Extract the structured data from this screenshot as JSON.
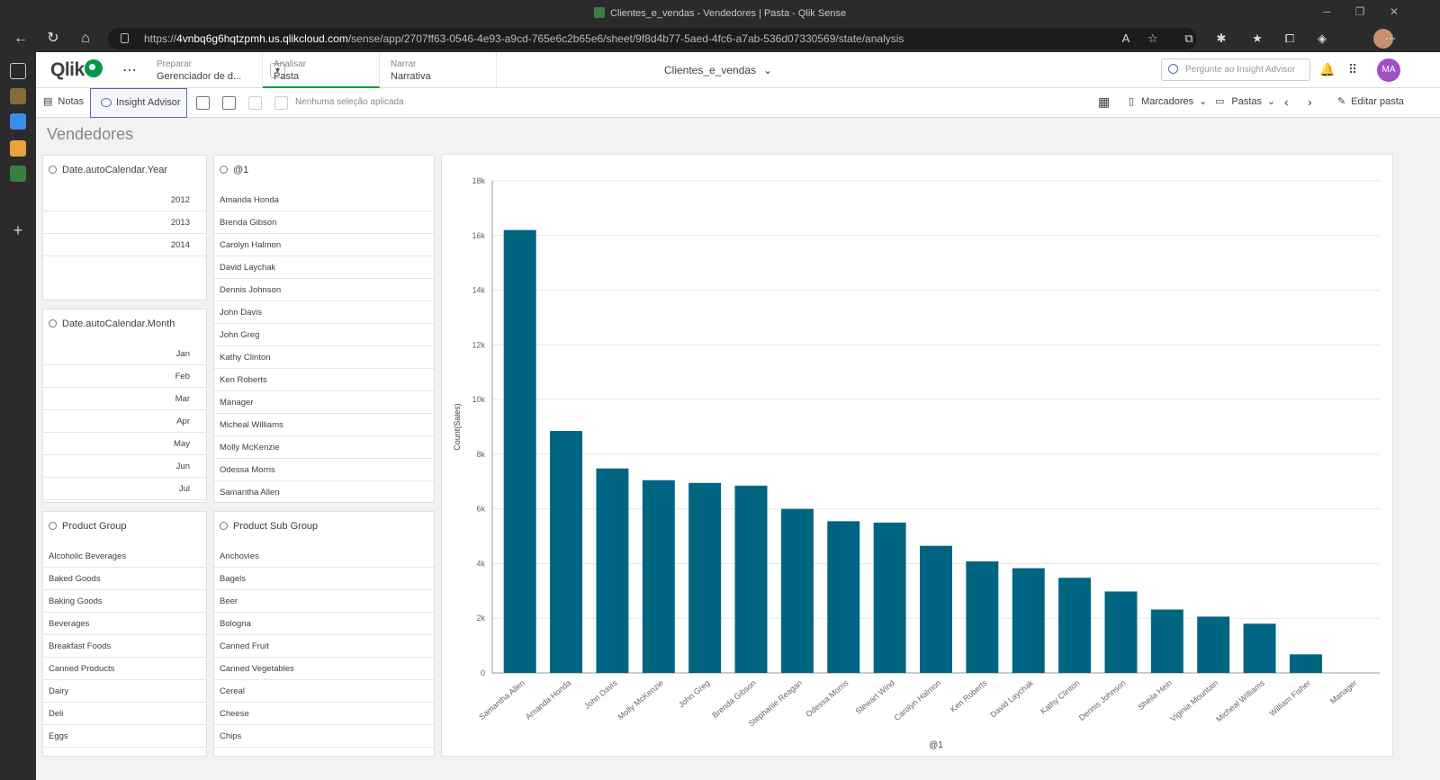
{
  "browser": {
    "tab_title": "Clientes_e_vendas - Vendedores | Pasta - Qlik Sense",
    "url_prefix": "https://",
    "url_host": "4vnbq6g6hqtzpmh.us.qlikcloud.com",
    "url_path": "/sense/app/2707ff63-0546-4e93-a9cd-765e6c2b65e6/sheet/9f8d4b77-5aed-4fc6-a7ab-536d07330569/state/analysis"
  },
  "header": {
    "logo": "Qlik",
    "tabs": [
      {
        "top": "Preparar",
        "bottom": "Gerenciador de d..."
      },
      {
        "top": "Analisar",
        "bottom": "Pasta"
      },
      {
        "top": "Narrar",
        "bottom": "Narrativa"
      }
    ],
    "app_name": "Clientes_e_vendas",
    "search_placeholder": "Pergunte ao Insight Advisor",
    "avatar": "MA"
  },
  "toolbar": {
    "notes": "Notas",
    "insight": "Insight Advisor",
    "selection_status": "Nenhuma seleção aplicada",
    "bookmarks": "Marcadores",
    "sheets": "Pastas",
    "edit": "Editar pasta"
  },
  "sheet_title": "Vendedores",
  "filters": {
    "year": {
      "title": "Date.autoCalendar.Year",
      "items": [
        "2012",
        "2013",
        "2014"
      ]
    },
    "month": {
      "title": "Date.autoCalendar.Month",
      "items": [
        "Jan",
        "Feb",
        "Mar",
        "Apr",
        "May",
        "Jun",
        "Jul"
      ]
    },
    "seller": {
      "title": "@1",
      "items": [
        "Amanda Honda",
        "Brenda Gibson",
        "Carolyn Halmon",
        "David Laychak",
        "Dennis Johnson",
        "John Davis",
        "John Greg",
        "Kathy Clinton",
        "Ken Roberts",
        "Manager",
        "Micheal Williams",
        "Molly McKenzie",
        "Odessa Morris",
        "Samantha Allen"
      ]
    },
    "product_group": {
      "title": "Product Group",
      "items": [
        "Alcoholic Beverages",
        "Baked Goods",
        "Baking Goods",
        "Beverages",
        "Breakfast Foods",
        "Canned Products",
        "Dairy",
        "Deli",
        "Eggs"
      ]
    },
    "product_sub_group": {
      "title": "Product Sub Group",
      "items": [
        "Anchovies",
        "Bagels",
        "Beer",
        "Bologna",
        "Canned Fruit",
        "Canned Vegetables",
        "Cereal",
        "Cheese",
        "Chips"
      ]
    }
  },
  "chart_data": {
    "type": "bar",
    "xlabel": "@1",
    "ylabel": "Count(Sales)",
    "ylim": [
      0,
      18000
    ],
    "yticks": [
      0,
      2000,
      4000,
      6000,
      8000,
      10000,
      12000,
      14000,
      16000,
      18000
    ],
    "ytick_labels": [
      "0",
      "2k",
      "4k",
      "6k",
      "8k",
      "10k",
      "12k",
      "14k",
      "16k",
      "18k"
    ],
    "categories": [
      "Samantha Allen",
      "Amanda Honda",
      "John Davis",
      "Molly McKenzie",
      "John Greg",
      "Brenda Gibson",
      "Stephanie Reagan",
      "Odessa Morris",
      "Stewart Wind",
      "Carolyn Halmon",
      "Ken Roberts",
      "David Laychak",
      "Kathy Clinton",
      "Dennis Johnson",
      "Sheila Hein",
      "Viginia Mountain",
      "Micheal Williams",
      "William Fisher",
      "Manager"
    ],
    "values": [
      16200,
      8850,
      7480,
      7050,
      6950,
      6850,
      6000,
      5550,
      5500,
      4650,
      4080,
      3830,
      3480,
      2980,
      2320,
      2060,
      1800,
      680,
      0
    ],
    "bar_color": "#006580",
    "grid": true
  }
}
